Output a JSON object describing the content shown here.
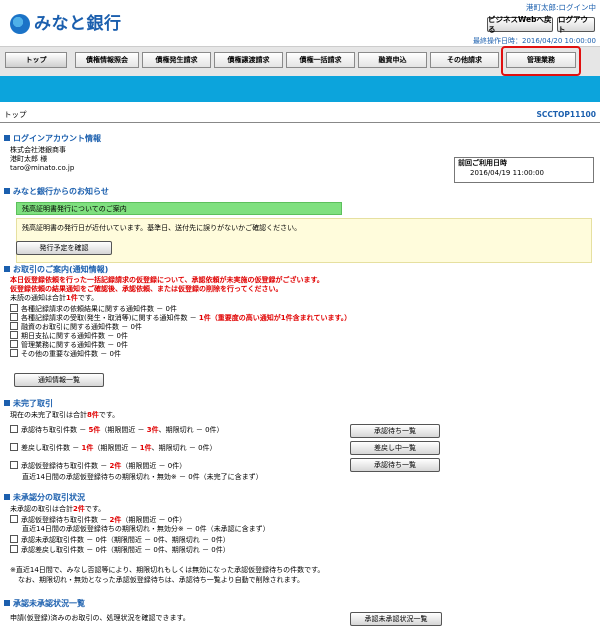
{
  "header": {
    "bank_name": "みなと銀行",
    "user_status": "港町太郎:ログイン中",
    "biz_web_button": "ビジネスWebへ戻る",
    "logout_button": "ログアウト",
    "last_operation": "最終操作日時：2016/04/20 10:00:00"
  },
  "nav": {
    "tabs": [
      "トップ",
      "債権情報照会",
      "債権発生請求",
      "債権譲渡請求",
      "債権一括請求",
      "融資申込",
      "その他請求",
      "管理業務"
    ]
  },
  "breadcrumb": "トップ",
  "screen_id": "SCCTOP11100",
  "login_info": {
    "title": "ログインアカウント情報",
    "company": "株式会社港銀商事",
    "user": "港町太郎 様",
    "email": "taro@minato.co.jp",
    "last_use_label": "前回ご利用日時",
    "last_use_value": "2016/04/19 11:00:00"
  },
  "notices": {
    "title": "みなと銀行からのお知らせ",
    "headline": "残高証明書発行についてのご案内",
    "body": "残高証明書の発行日が近付いています。基準日、送付先に誤りがないかご確認ください。",
    "button": "発行予定を確認"
  },
  "guidance": {
    "title": "お取引のご案内(通知情報)",
    "warn1": "本日仮登録依頼を行った一括記録請求の仮登録について、承認依頼が未実施の仮登録がございます。",
    "warn2": "仮登録依頼の結果通知をご確認後、承認依頼、または仮登録の削除を行ってください。",
    "unread_pre": "未読の通知は合計",
    "unread_count": "1件",
    "unread_post": "です。",
    "items": [
      {
        "text": "各種記録請求の依頼結果に関する通知件数 － 0件",
        "extra": ""
      },
      {
        "text": "各種記録請求の受取(発生・取消等)に関する通知件数 － ",
        "extra": "1件（重要度の高い通知が1件含まれています。）"
      },
      {
        "text": "融資のお取引に関する通知件数 － 0件",
        "extra": ""
      },
      {
        "text": "期日支払に関する通知件数 － 0件",
        "extra": ""
      },
      {
        "text": "管理業務に関する通知件数 － 0件",
        "extra": ""
      },
      {
        "text": "その他の重要な通知件数 － 0件",
        "extra": ""
      }
    ],
    "button": "通知情報一覧"
  },
  "incomplete": {
    "title": "未完了取引",
    "summary_pre": "現在の未完了取引は合計",
    "summary_count": "8件",
    "summary_post": "です。",
    "row1_pre": "承認待ち取引件数 － ",
    "row1_count": "5件",
    "row1_mid": "（期限間近 － ",
    "row1_near": "3件",
    "row1_post": "、期限切れ － 0件）",
    "row1_button": "承認待ち一覧",
    "row2_pre": "差戻し取引件数 － ",
    "row2_count": "1件",
    "row2_mid": "（期限間近 － ",
    "row2_near": "1件",
    "row2_post": "、期限切れ － 0件）",
    "row2_button": "差戻し中一覧",
    "row3_pre": "承認仮登録待ち取引件数 － ",
    "row3_count": "2件",
    "row3_post": "（期限間近 － 0件）",
    "row3_button": "承認待ち一覧",
    "row3_sub": "直近14日間の承認仮登録待ちの期限切れ・無効※ － 0件（未完了に含まず）"
  },
  "unapproved": {
    "title": "未承認分の取引状況",
    "summary_pre": "未承認の取引は合計",
    "summary_count": "2件",
    "summary_post": "です。",
    "row1_pre": "承認仮登録待ち取引件数 － ",
    "row1_count": "2件",
    "row1_post": "（期限間近 － 0件）",
    "row1_sub": "直近14日間の承認仮登録待ちの期限切れ・無効分※ － 0件（未承認に含まず）",
    "row2": "承認未承認取引件数 － 0件（期限間近 － 0件、期限切れ － 0件）",
    "row3": "承認差戻し取引件数 － 0件（期限間近 － 0件、期限切れ － 0件）",
    "note1": "※直近14日間で、みなし否認等により、期限切れもしくは無効になった承認仮登録待ちの件数です。",
    "note2": "なお、期限切れ・無効となった承認仮登録待ちは、承認待ち一覧より自動で削除されます。"
  },
  "approval_list": {
    "title": "承認未承認状況一覧",
    "text": "申請(仮登録)済みのお取引の、処理状況を確認できます。",
    "button": "承認未承認状況一覧"
  },
  "colors": {
    "brand_blue": "#1b5fae",
    "band": "#0ca4dc",
    "alert_red": "#e00000",
    "highlight": "#e01010"
  }
}
